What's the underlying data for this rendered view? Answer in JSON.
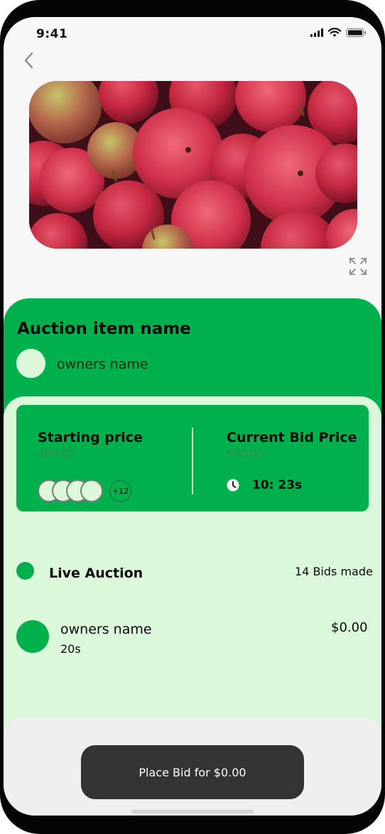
{
  "status_bar": {
    "time": "9:41",
    "icons": [
      "signal-icon",
      "wifi-icon",
      "battery-icon"
    ]
  },
  "navigation": {
    "back_icon": "chevron-left-icon"
  },
  "hero": {
    "image_subject": "red apples",
    "expand_icon": "expand-icon"
  },
  "item": {
    "title": "Auction item name",
    "owner_name": "owners name"
  },
  "price_card": {
    "starting_label": "Starting price",
    "starting_value": "400.00",
    "current_label": "Current Bid Price",
    "current_value": "600.00",
    "extra_bidders": "+12",
    "countdown": "10: 23s",
    "clock_icon": "clock-icon"
  },
  "live": {
    "label": "Live Auction",
    "bid_count": "14 Bids made"
  },
  "bids": [
    {
      "name": "owners name",
      "time": "20s",
      "amount": "$0.00"
    }
  ],
  "action": {
    "place_bid_label": "Place Bid for $0.00"
  },
  "colors": {
    "primary_green": "#00b04c",
    "light_green": "#dcf8db",
    "button_dark": "#333333"
  }
}
